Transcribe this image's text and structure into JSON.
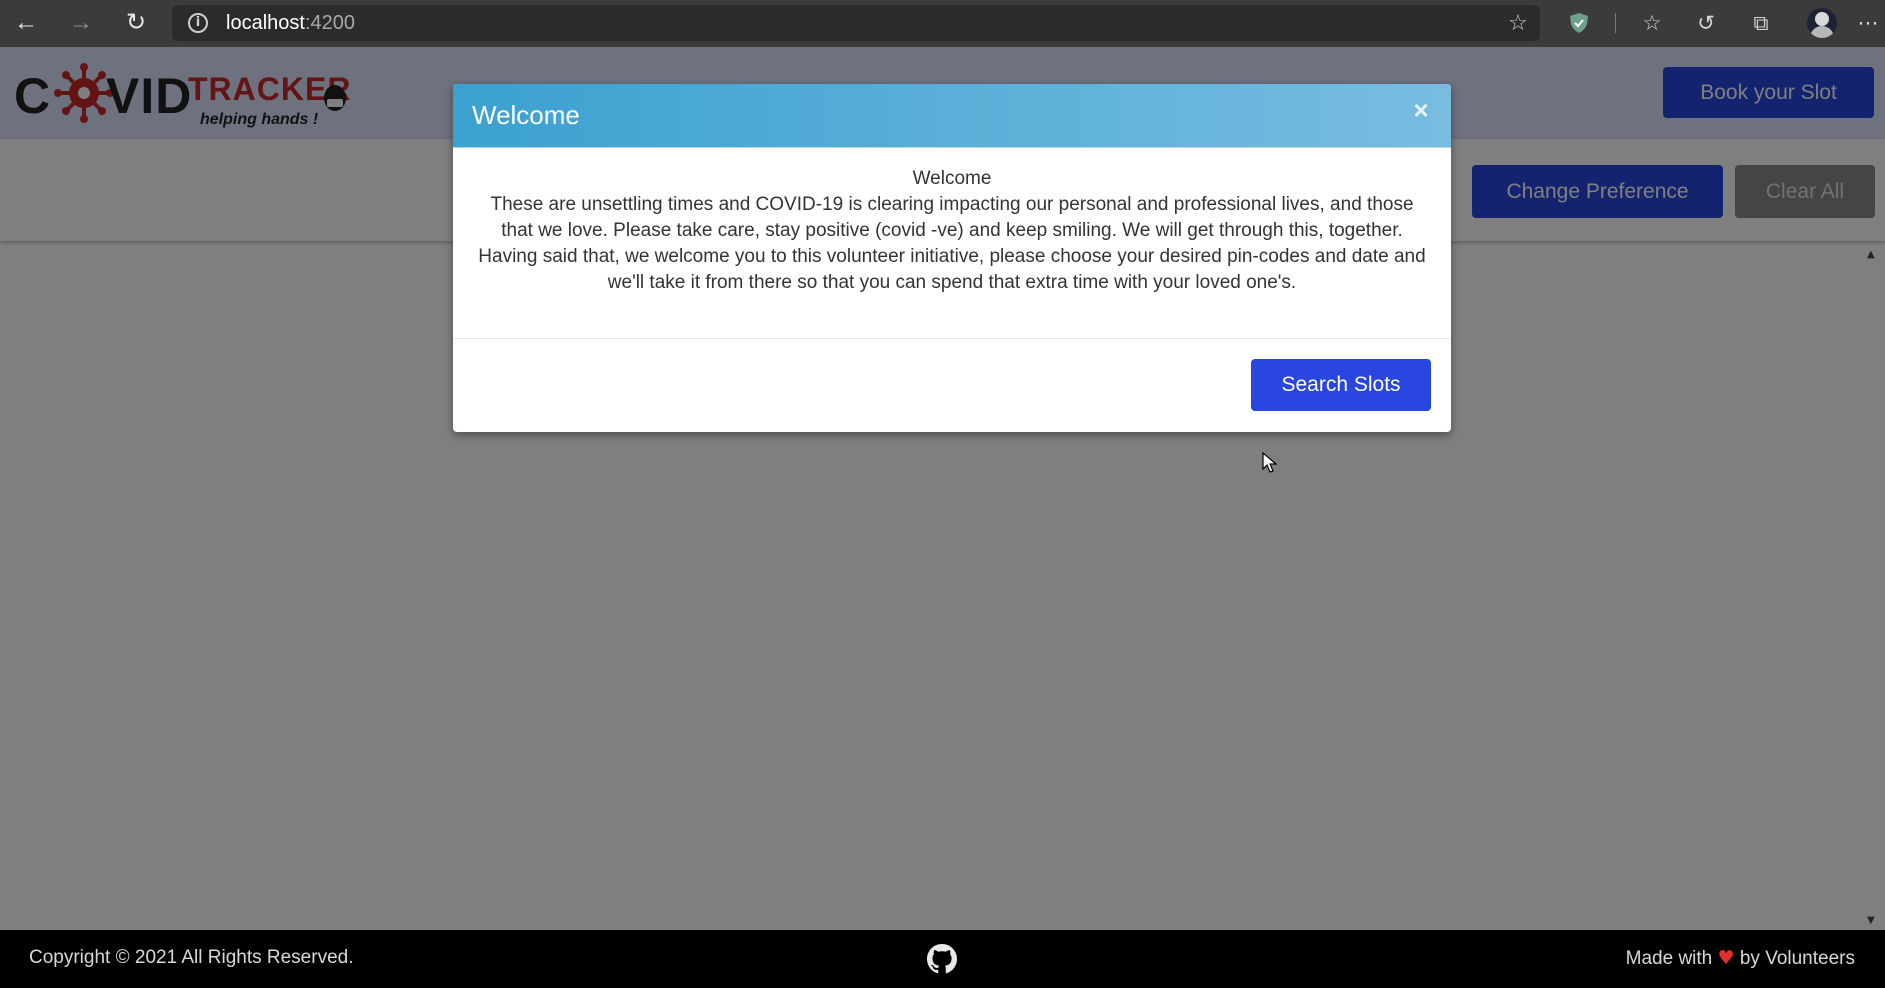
{
  "browser": {
    "url_host": "localhost",
    "url_port": ":4200",
    "icons": {
      "back": "back-arrow-icon",
      "forward": "forward-arrow-icon",
      "reload": "reload-icon",
      "site_info": "info-icon",
      "add_favorite": "star-add-icon",
      "extension": "shield-icon",
      "favorites": "favorites-icon",
      "history": "history-icon",
      "collections": "collections-icon",
      "profile": "profile-avatar",
      "menu": "more-icon"
    }
  },
  "header": {
    "logo": {
      "covid_c": "C",
      "covid_vid": "VID",
      "tracker": "TRACKER",
      "tagline": "helping hands !"
    },
    "book_button": "Book your Slot"
  },
  "toolbar": {
    "change_preference": "Change Preference",
    "clear_all": "Clear All"
  },
  "modal": {
    "title": "Welcome",
    "close": "×",
    "heading": "Welcome",
    "message": "These are unsettling times and COVID-19 is clearing impacting our personal and professional lives, and those that we love. Please take care, stay positive (covid -ve) and keep smiling. We will get through this, together. Having said that, we welcome you to this volunteer initiative, please choose your desired pin-codes and date and we'll take it from there so that you can spend that extra time with your loved one's.",
    "search_button": "Search Slots"
  },
  "footer": {
    "copyright": "Copyright © 2021 All Rights Reserved.",
    "made_with_prefix": "Made with",
    "heart": "♥",
    "made_with_suffix": "by Volunteers"
  },
  "colors": {
    "primary": "#2946e0",
    "secondary": "#8a8a8a",
    "modal_header_start": "#3ba1d0",
    "modal_header_end": "#78bde0",
    "header_bg": "#dde5ff",
    "tracker_red": "#c62828",
    "heart": "#e0312c"
  }
}
